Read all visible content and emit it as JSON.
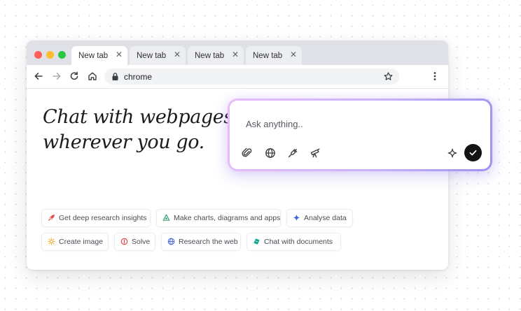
{
  "browser": {
    "tabs": [
      {
        "label": "New tab",
        "close": "✕"
      },
      {
        "label": "New tab",
        "close": "✕"
      },
      {
        "label": "New tab",
        "close": "✕"
      },
      {
        "label": "New tab",
        "close": "✕"
      }
    ],
    "address_bar": {
      "url": "chrome"
    },
    "icons": [
      "back-icon",
      "forward-icon",
      "reload-icon",
      "home-icon",
      "lock-icon",
      "star-icon",
      "menu-icon"
    ]
  },
  "headline": {
    "line1": "Chat with webpages,",
    "line2": "wherever you go."
  },
  "prompt": {
    "placeholder": "Ask anything..",
    "tools": [
      "attach-icon",
      "globe-icon",
      "plug-icon",
      "telescope-icon",
      "sparkle-icon"
    ],
    "send_icon": "check-icon"
  },
  "suggestions": [
    {
      "label": "Get deep research insights",
      "icon": "rocket-icon",
      "color": "#e5484d"
    },
    {
      "label": "Make charts, diagrams and apps",
      "icon": "shapes-icon",
      "color": "#30a46c"
    },
    {
      "label": "Analyse data",
      "icon": "sparkle-icon",
      "color": "#3e63dd"
    },
    {
      "label": "Create image",
      "icon": "sun-icon",
      "color": "#f5a524"
    },
    {
      "label": "Solve",
      "icon": "solve-icon",
      "color": "#e5484d"
    },
    {
      "label": "Research the web",
      "icon": "globe-icon",
      "color": "#3e63dd"
    },
    {
      "label": "Chat with documents",
      "icon": "doc-icon",
      "color": "#12a594"
    }
  ],
  "colors": {
    "send_button": "#141416",
    "prompt_border_start": "#e7bdfb",
    "prompt_border_end": "#9c93f1"
  }
}
